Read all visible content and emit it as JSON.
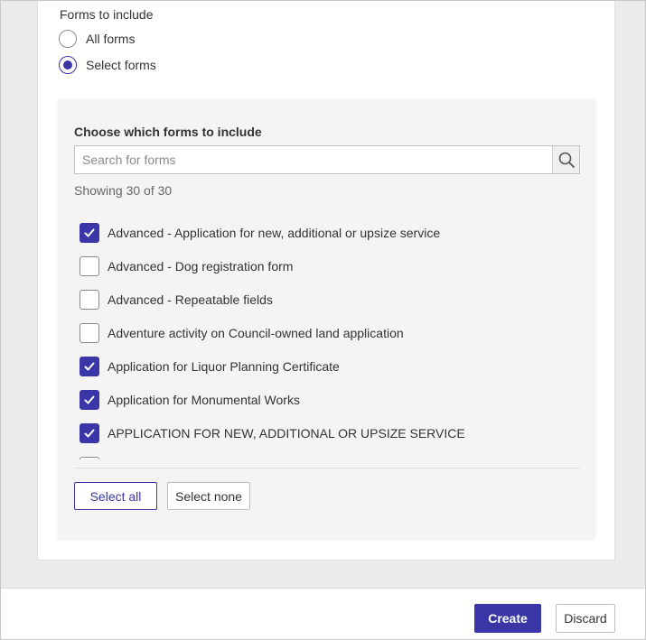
{
  "forms_section": {
    "label": "Forms to include",
    "options": [
      {
        "label": "All forms",
        "selected": false
      },
      {
        "label": "Select forms",
        "selected": true
      }
    ]
  },
  "chooser": {
    "title": "Choose which forms to include",
    "search_placeholder": "Search for forms",
    "search_value": "",
    "showing_text": "Showing 30 of 30",
    "forms": [
      {
        "label": "Advanced - Application for new, additional or upsize service",
        "checked": true
      },
      {
        "label": "Advanced - Dog registration form",
        "checked": false
      },
      {
        "label": "Advanced - Repeatable fields",
        "checked": false
      },
      {
        "label": "Adventure activity on Council-owned land application",
        "checked": false
      },
      {
        "label": "Application for Liquor Planning Certificate",
        "checked": true
      },
      {
        "label": "Application for Monumental Works",
        "checked": true
      },
      {
        "label": "APPLICATION FOR NEW, ADDITIONAL OR UPSIZE SERVICE",
        "checked": true
      }
    ],
    "select_all_label": "Select all",
    "select_none_label": "Select none"
  },
  "footer": {
    "create_label": "Create",
    "discard_label": "Discard"
  },
  "colors": {
    "accent": "#3a36a8",
    "panel_bg": "#f4f4f4",
    "page_bg": "#ebebeb"
  }
}
